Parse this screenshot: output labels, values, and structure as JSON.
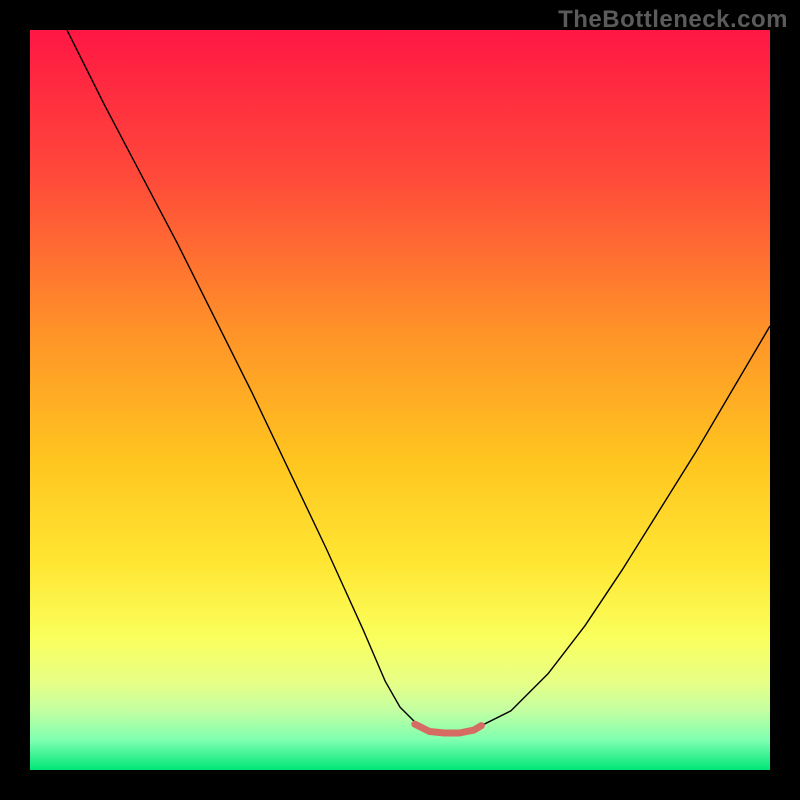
{
  "watermark": "TheBottleneck.com",
  "chart_data": {
    "type": "line",
    "title": "",
    "xlabel": "",
    "ylabel": "",
    "xlim": [
      0,
      100
    ],
    "ylim": [
      0,
      100
    ],
    "grid": false,
    "legend": false,
    "background_gradient": {
      "stops": [
        {
          "offset": 0.0,
          "color": "#ff1744"
        },
        {
          "offset": 0.2,
          "color": "#ff4a3a"
        },
        {
          "offset": 0.4,
          "color": "#ff9029"
        },
        {
          "offset": 0.58,
          "color": "#ffc51f"
        },
        {
          "offset": 0.72,
          "color": "#ffe633"
        },
        {
          "offset": 0.82,
          "color": "#faff5c"
        },
        {
          "offset": 0.88,
          "color": "#e8ff85"
        },
        {
          "offset": 0.92,
          "color": "#c3ffa2"
        },
        {
          "offset": 0.96,
          "color": "#7dffb0"
        },
        {
          "offset": 1.0,
          "color": "#00e676"
        }
      ]
    },
    "series": [
      {
        "name": "bottleneck-curve",
        "stroke": "#000000",
        "stroke_width": 1.4,
        "x": [
          5,
          10,
          15,
          20,
          25,
          30,
          35,
          40,
          45,
          48,
          50,
          52,
          55,
          58,
          60,
          65,
          70,
          75,
          80,
          85,
          90,
          95,
          100
        ],
        "y": [
          100,
          90,
          80.5,
          71,
          61,
          51,
          40.5,
          30,
          19,
          12,
          8.5,
          6.5,
          5,
          5,
          5.5,
          8,
          13,
          19.5,
          27,
          35,
          43,
          51.5,
          60
        ]
      },
      {
        "name": "optimal-zone-highlight",
        "stroke": "#d56b63",
        "stroke_width": 7,
        "linecap": "round",
        "x": [
          52,
          54,
          56,
          58,
          60,
          61
        ],
        "y": [
          6.2,
          5.2,
          5.0,
          5.0,
          5.4,
          6.0
        ]
      }
    ]
  }
}
